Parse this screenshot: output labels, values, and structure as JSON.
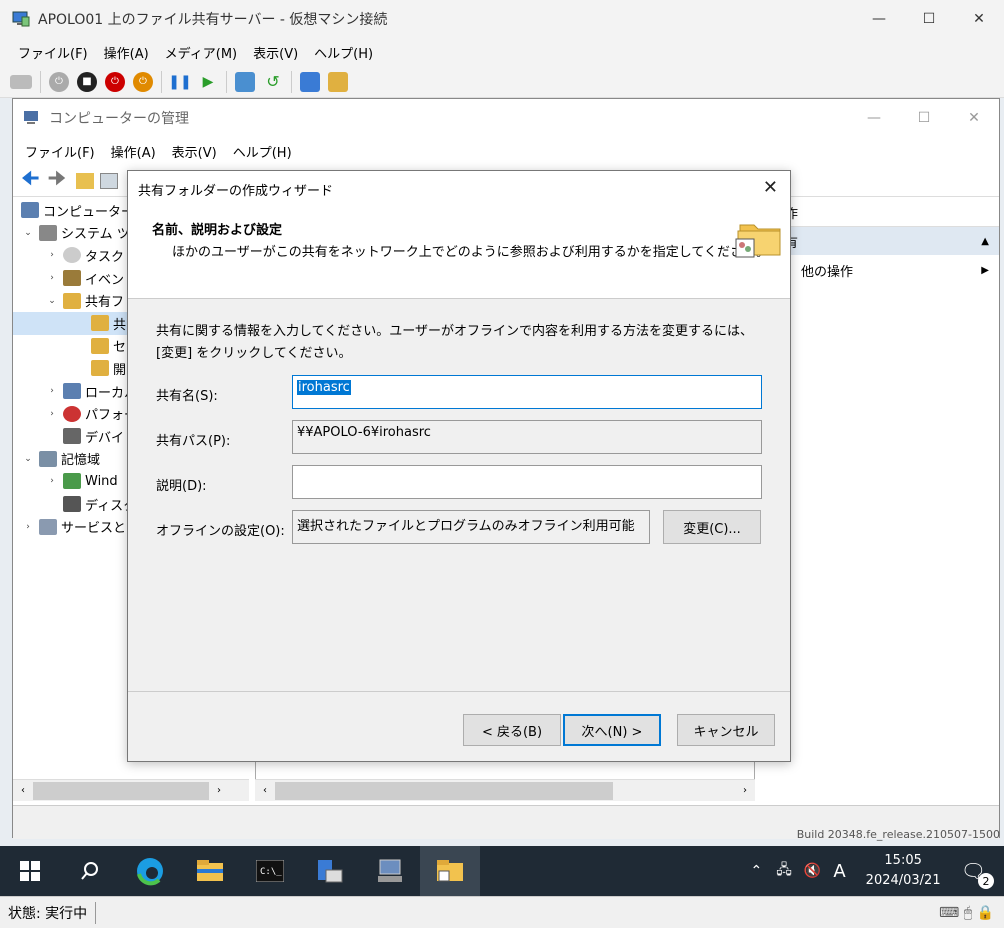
{
  "vm": {
    "title": "APOLO01 上のファイル共有サーバー - 仮想マシン接続",
    "menu": [
      "ファイル(F)",
      "操作(A)",
      "メディア(M)",
      "表示(V)",
      "ヘルプ(H)"
    ],
    "status_text": "状態: 実行中"
  },
  "cm": {
    "title": "コンピューターの管理",
    "menu": [
      "ファイル(F)",
      "操作(A)",
      "表示(V)",
      "ヘルプ(H)"
    ],
    "tree": [
      "コンピューターの",
      "システム ツ",
      "タスク",
      "イベン",
      "共有フ",
      "共",
      "セ",
      "開",
      "ローカル",
      "パフォー",
      "デバイ",
      "記憶域",
      "Wind",
      "ディスク",
      "サービスとア"
    ],
    "ops": {
      "header": "作",
      "sub_header": "有",
      "more_actions": "他の操作"
    },
    "build_text": "Build 20348.fe_release.210507-1500"
  },
  "wizard": {
    "title": "共有フォルダーの作成ウィザード",
    "heading": "名前、説明および設定",
    "subheading": "ほかのユーザーがこの共有をネットワーク上でどのように参照および利用するかを指定してください。",
    "instructions": "共有に関する情報を入力してください。ユーザーがオフラインで内容を利用する方法を変更するには、[変更] をクリックしてください。",
    "share_name_label": "共有名(S):",
    "share_name_value": "irohasrc",
    "share_path_label": "共有パス(P):",
    "share_path_value": "¥¥APOLO-6¥irohasrc",
    "description_label": "説明(D):",
    "description_value": "",
    "offline_label": "オフラインの設定(O):",
    "offline_value": "選択されたファイルとプログラムのみオフライン利用可能",
    "change_button": "変更(C)...",
    "back_button": "< 戻る(B)",
    "next_button": "次へ(N) >",
    "cancel_button": "キャンセル"
  },
  "taskbar": {
    "time": "15:05",
    "date": "2024/03/21",
    "ime": "A",
    "notification_count": "2"
  },
  "colors": {
    "accent": "#0078d4",
    "taskbar": "#1f2a35",
    "dialog_bg": "#f0f0f0"
  }
}
